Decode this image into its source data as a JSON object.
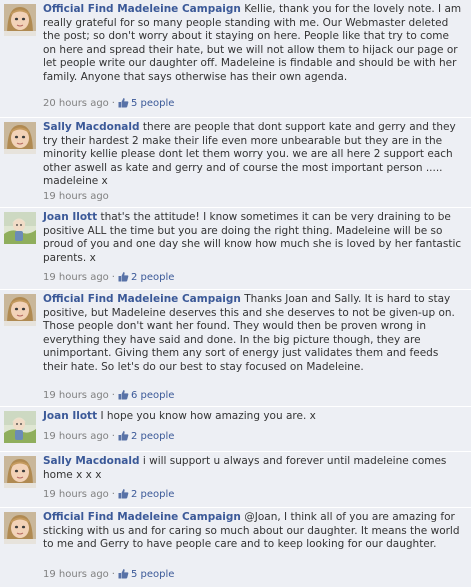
{
  "colors": {
    "link": "#3b5998",
    "text": "#333333",
    "meta": "#808080",
    "row_bg": "#edeff4"
  },
  "comments": [
    {
      "author": "Official Find Madeleine Campaign",
      "text": "Kellie, thank you for the lovely note. I am really grateful for so many people standing with me. Our Webmaster deleted the post; so don't worry about it staying on here. People like that try to come on here and spread their hate, but we will not allow them to hijack our page or let people write our daughter off. Madeleine is findable and should be with her family. Anyone that says otherwise has their own agenda.",
      "time": "20 hours ago",
      "likes": "5 people",
      "avatar": "madeleine-avatar"
    },
    {
      "author": "Sally Macdonald",
      "text": "there are people that dont support kate and gerry and they try their hardest 2 make their life even more unbearable but they are in the minority kellie please dont let them worry you. we are all here 2 support each other aswell as kate and gerry and of course the most important person ..... madeleine x",
      "time": "19 hours ago",
      "likes": "",
      "avatar": "madeleine-avatar"
    },
    {
      "author": "Joan Ilott",
      "text": "that's the attitude! I know sometimes it can be very draining to be positive ALL the time but you are doing the right thing. Madeleine will be so proud of you and one day she will know how much she is loved by her fantastic parents. x",
      "time": "19 hours ago",
      "likes": "2 people",
      "avatar": "outdoor-avatar"
    },
    {
      "author": "Official Find Madeleine Campaign",
      "text": "Thanks Joan and Sally. It is hard to stay positive, but Madeleine deserves this and she deserves to not be given-up on. Those people don't want her found. They would then be proven wrong in everything they have said and done. In the big picture though, they are unimportant. Giving them any sort of energy just validates them and feeds their hate. So let's do our best to stay focused on Madeleine.",
      "time": "19 hours ago",
      "likes": "6 people",
      "avatar": "madeleine-avatar"
    },
    {
      "author": "Joan Ilott",
      "text": "I hope you know how amazing you are. x",
      "time": "19 hours ago",
      "likes": "2 people",
      "avatar": "outdoor-avatar"
    },
    {
      "author": "Sally Macdonald",
      "text": "i will support u always and forever until madeleine comes home x x x",
      "time": "19 hours ago",
      "likes": "2 people",
      "avatar": "madeleine-avatar"
    },
    {
      "author": "Official Find Madeleine Campaign",
      "text": "@Joan, I think all of you are amazing for sticking with us and for caring so much about our daughter. It means the world to me and Gerry to have people care and to keep looking for our daughter.",
      "time": "19 hours ago",
      "likes": "5 people",
      "avatar": "madeleine-avatar"
    }
  ]
}
